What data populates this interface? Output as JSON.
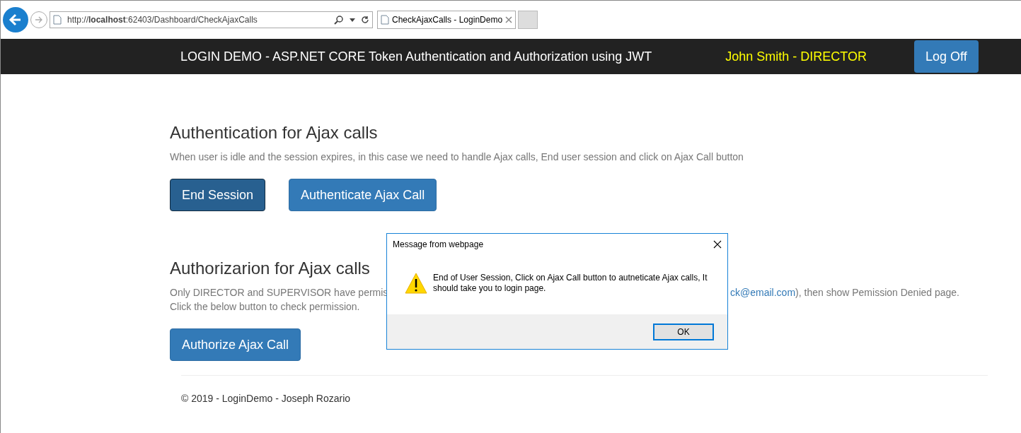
{
  "browser": {
    "address": "http://**localhost**:62403/Dashboard/CheckAjaxCalls",
    "tab_title": "CheckAjaxCalls - LoginDemo"
  },
  "navbar": {
    "title": "LOGIN DEMO - ASP.NET CORE Token Authentication and Authorization using JWT",
    "user": "John Smith - DIRECTOR",
    "button": "Log Off"
  },
  "sections": [
    {
      "heading": "Authentication for Ajax calls",
      "lines": [
        {
          "left": "When user is idle and the session expires, in this case we need to handle Ajax calls, End user session and click on Ajax Call button"
        }
      ],
      "buttons": [
        {
          "label": "End Session",
          "active": true
        },
        {
          "label": "Authenticate Ajax Call",
          "active": false
        }
      ]
    },
    {
      "heading": "Authorizarion for Ajax calls",
      "lines": [
        {
          "left": "Only DIRECTOR and SUPERVISOR have permis",
          "link": "ck@email.com",
          "right": "), then show Pemission Denied page."
        },
        {
          "left": "Click the below button to check permission."
        }
      ],
      "buttons": [
        {
          "label": "Authorize Ajax Call",
          "active": false
        }
      ]
    }
  ],
  "dialog": {
    "title": "Message from webpage",
    "message": "End of User Session, Click on Ajax Call button to autneticate Ajax calls, It should take you to login page.",
    "button": "OK"
  },
  "footer": "© 2019 - LoginDemo - Joseph Rozario"
}
